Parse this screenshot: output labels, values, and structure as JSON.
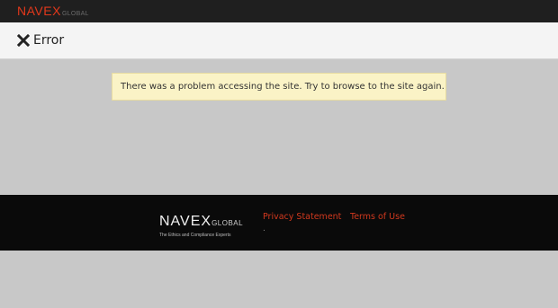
{
  "header": {
    "logo_text": "NAVEX",
    "logo_sub": "GLOBAL"
  },
  "titlebar": {
    "icon": "close-x-icon",
    "title": "Error"
  },
  "alert": {
    "message": "There was a problem accessing the site. Try to browse to the site again."
  },
  "footer": {
    "logo_text": "NAVEX",
    "logo_sub": "GLOBAL",
    "tagline": "The Ethics and Compliance Experts",
    "links": [
      {
        "label": "Privacy Statement"
      },
      {
        "label": "Terms of Use"
      }
    ],
    "separator": "."
  },
  "colors": {
    "brand_red": "#e2381b",
    "link_red": "#d2391e",
    "alert_bg": "#faf3c6",
    "topbar": "#1f1f1f",
    "footer": "#0a0a0a",
    "page_bg": "#c8c8c8"
  }
}
